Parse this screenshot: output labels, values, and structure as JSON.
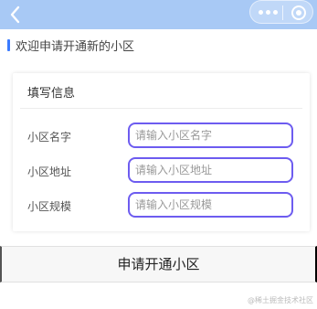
{
  "navbar": {
    "back_icon": "chevron-left-icon",
    "menu_icon": "more-dots-icon",
    "close_icon": "target-circle-icon",
    "color": "#a8c9f5"
  },
  "welcome": {
    "text": "欢迎申请开通新的小区",
    "accent": "#3a7bff"
  },
  "form": {
    "title": "填写信息",
    "fields": [
      {
        "label": "小区名字",
        "placeholder": "请输入小区名字"
      },
      {
        "label": "小区地址",
        "placeholder": "请输入小区地址"
      },
      {
        "label": "小区规模",
        "placeholder": "请输入小区规模"
      }
    ],
    "input_border_color": "#6d5cf0"
  },
  "submit": {
    "label": "申请开通小区"
  },
  "watermark": "@稀土掘金技术社区"
}
